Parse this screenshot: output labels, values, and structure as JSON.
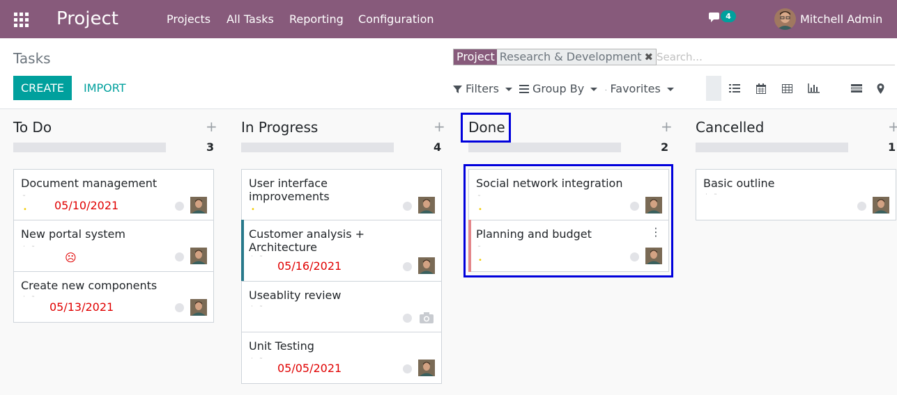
{
  "navbar": {
    "app_title": "Project",
    "menu": [
      "Projects",
      "All Tasks",
      "Reporting",
      "Configuration"
    ],
    "chat_badge": "4",
    "user_name": "Mitchell Admin"
  },
  "control_panel": {
    "breadcrumb": "Tasks",
    "create_label": "CREATE",
    "import_label": "IMPORT",
    "facet_label": "Project",
    "facet_value": "Research & Development",
    "search_placeholder": "Search...",
    "filters_label": "Filters",
    "groupby_label": "Group By",
    "favorites_label": "Favorites",
    "views": [
      "kanban-view-icon",
      "list-view-icon",
      "calendar-view-icon",
      "pivot-view-icon",
      "graph-view-icon",
      "activity-view-icon",
      "map-view-icon"
    ]
  },
  "columns": [
    {
      "title": "To Do",
      "count": "3",
      "cards": [
        {
          "title": "Document management",
          "date": "05/10/2021"
        },
        {
          "title": "New portal system",
          "date": ""
        },
        {
          "title": "Create new components",
          "date": "05/13/2021"
        }
      ]
    },
    {
      "title": "In Progress",
      "count": "4",
      "cards": [
        {
          "title": "User interface improvements",
          "date": ""
        },
        {
          "title": "Customer analysis + Architecture",
          "date": "05/16/2021"
        },
        {
          "title": "Useablity review",
          "date": ""
        },
        {
          "title": "Unit Testing",
          "date": "05/05/2021"
        }
      ]
    },
    {
      "title": "Done",
      "count": "2",
      "cards": [
        {
          "title": "Social network integration",
          "date": ""
        },
        {
          "title": "Planning and budget",
          "date": ""
        }
      ]
    },
    {
      "title": "Cancelled",
      "count": "1",
      "cards": [
        {
          "title": "Basic outline",
          "date": ""
        }
      ]
    }
  ],
  "colors": {
    "brand": "#875a7b",
    "primary": "#00a09d",
    "deadline_overdue": "#e00000",
    "highlight": "#0000dc"
  }
}
